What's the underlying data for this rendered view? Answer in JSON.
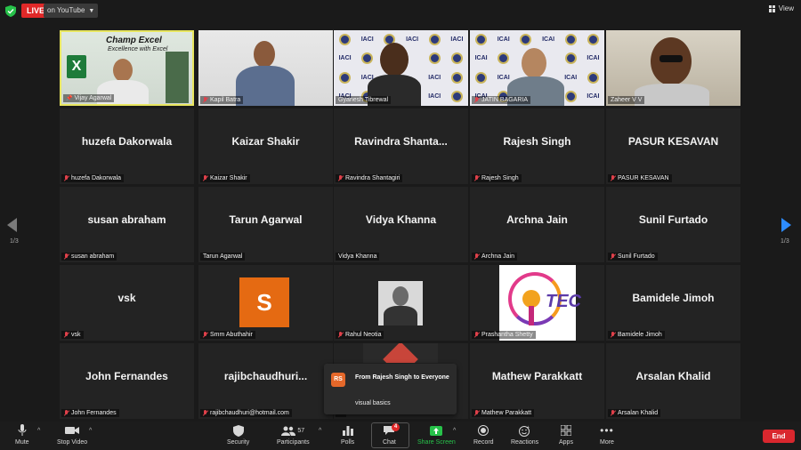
{
  "topbar": {
    "live_label": "LIVE",
    "stream_target": "on YouTube",
    "view_label": "View"
  },
  "gallery": {
    "page_indicator_left": "1/3",
    "page_indicator_right": "1/3",
    "tiles": [
      {
        "label": "Vijay Agarwal",
        "banner_title": "Champ Excel",
        "banner_sub": "Excellence with Excel"
      },
      {
        "label": "Kapil Batra"
      },
      {
        "label": "Gyanesh Tibrewal",
        "watermark": "IACI"
      },
      {
        "label": "JATIN BAGARIA",
        "watermark": "ICAI"
      },
      {
        "label": "Zaheer V V"
      },
      {
        "display": "huzefa Dakorwala",
        "label": "huzefa Dakorwala"
      },
      {
        "display": "Kaizar Shakir",
        "label": "Kaizar Shakir"
      },
      {
        "display": "Ravindra  Shanta...",
        "label": "Ravindra Shantagiri"
      },
      {
        "display": "Rajesh Singh",
        "label": "Rajesh Singh"
      },
      {
        "display": "PASUR KESAVAN",
        "label": "PASUR KESAVAN"
      },
      {
        "display": "susan abraham",
        "label": "susan abraham"
      },
      {
        "display": "Tarun Agarwal",
        "label": "Tarun Agarwal"
      },
      {
        "display": "Vidya Khanna",
        "label": "Vidya Khanna"
      },
      {
        "display": "Archna Jain",
        "label": "Archna Jain"
      },
      {
        "display": "Sunil Furtado",
        "label": "Sunil Furtado"
      },
      {
        "display": "vsk",
        "label": "vsk"
      },
      {
        "avatar_letter": "S",
        "label": "Smm Abuthahir"
      },
      {
        "label": "Rahul Neotia"
      },
      {
        "logo_text": "TEC",
        "label": "Prashantha Shetty"
      },
      {
        "display": "Bamidele Jimoh",
        "label": "Bamidele Jimoh"
      },
      {
        "display": "John Fernandes",
        "label": "John Fernandes"
      },
      {
        "display": "rajibchaudhuri...",
        "label": "rajibchaudhuri@hotmail.com"
      },
      {
        "label": "..."
      },
      {
        "display": "Mathew Parakkatt",
        "label": "Mathew Parakkatt"
      },
      {
        "display": "Arsalan Khalid",
        "label": "Arsalan Khalid"
      }
    ]
  },
  "chat_popup": {
    "initials": "RS",
    "from": "From Rajesh Singh to Everyone",
    "message": "visual basics"
  },
  "toolbar": {
    "mute": "Mute",
    "stop_video": "Stop Video",
    "security": "Security",
    "participants": "Participants",
    "participants_count": "57",
    "polls": "Polls",
    "chat": "Chat",
    "chat_badge": "4",
    "share_screen": "Share Screen",
    "record": "Record",
    "reactions": "Reactions",
    "apps": "Apps",
    "more": "More",
    "end": "End"
  },
  "colors": {
    "live_red": "#e02828",
    "active_speaker": "#e8e660",
    "share_green": "#27c24a",
    "nav_blue": "#2d8cff",
    "end_red": "#d9272e"
  }
}
